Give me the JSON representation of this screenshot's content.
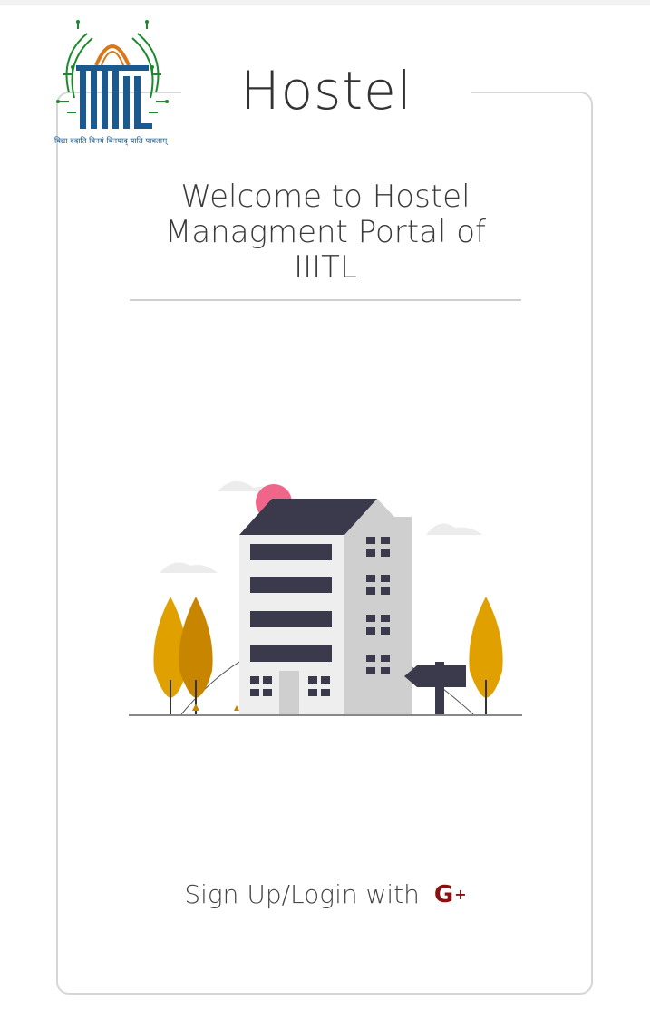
{
  "header": {
    "title": "Hostel",
    "logo_motto": "विद्या ददाति विनयं विनयाद् याति पात्रताम्"
  },
  "card": {
    "welcome": "Welcome to Hostel Managment Portal of IIITL"
  },
  "login": {
    "label": "Sign Up/Login with",
    "provider_icon": "google-plus-icon",
    "provider_text": "G",
    "provider_plus": "+"
  },
  "colors": {
    "accent": "#8a1111",
    "logo_blue": "#1a5a8f",
    "logo_green": "#1a8a2a",
    "tree_gold": "#e0a000",
    "building_dark": "#3b3a4c"
  }
}
